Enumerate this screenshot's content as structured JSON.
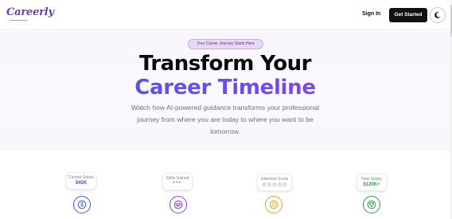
{
  "header": {
    "logo": "Careerly",
    "sign_in": "Sign In",
    "get_started": "Get Started",
    "theme_toggle_icon": "moon-icon"
  },
  "hero": {
    "badge": "Your Career Journey Starts Here",
    "title_line1": "Transform Your",
    "title_line2": "Career Timeline",
    "subtitle": "Watch how AI-powered guidance transforms your professional journey from where you are today to where you want to be tomorrow."
  },
  "stats": [
    {
      "label": "Current Salary",
      "value": "$45K",
      "color": "#3b5bd6"
    },
    {
      "label": "Skills Gained",
      "value": "•••",
      "color": "#7b3fc8"
    },
    {
      "label": "Interview Score",
      "value": "☆☆☆☆☆",
      "color": "#222222"
    },
    {
      "label": "New Salary",
      "value": "$120K+",
      "color": "#2e9a4a"
    }
  ],
  "timeline_icons": [
    {
      "icon": "dollar-icon",
      "color": "#3b5bd6"
    },
    {
      "icon": "graduation-cap-icon",
      "color": "#8b3fc8"
    },
    {
      "icon": "chat-bubble-icon",
      "color": "#e8a020"
    },
    {
      "icon": "trophy-icon",
      "color": "#2e9a4a"
    }
  ]
}
